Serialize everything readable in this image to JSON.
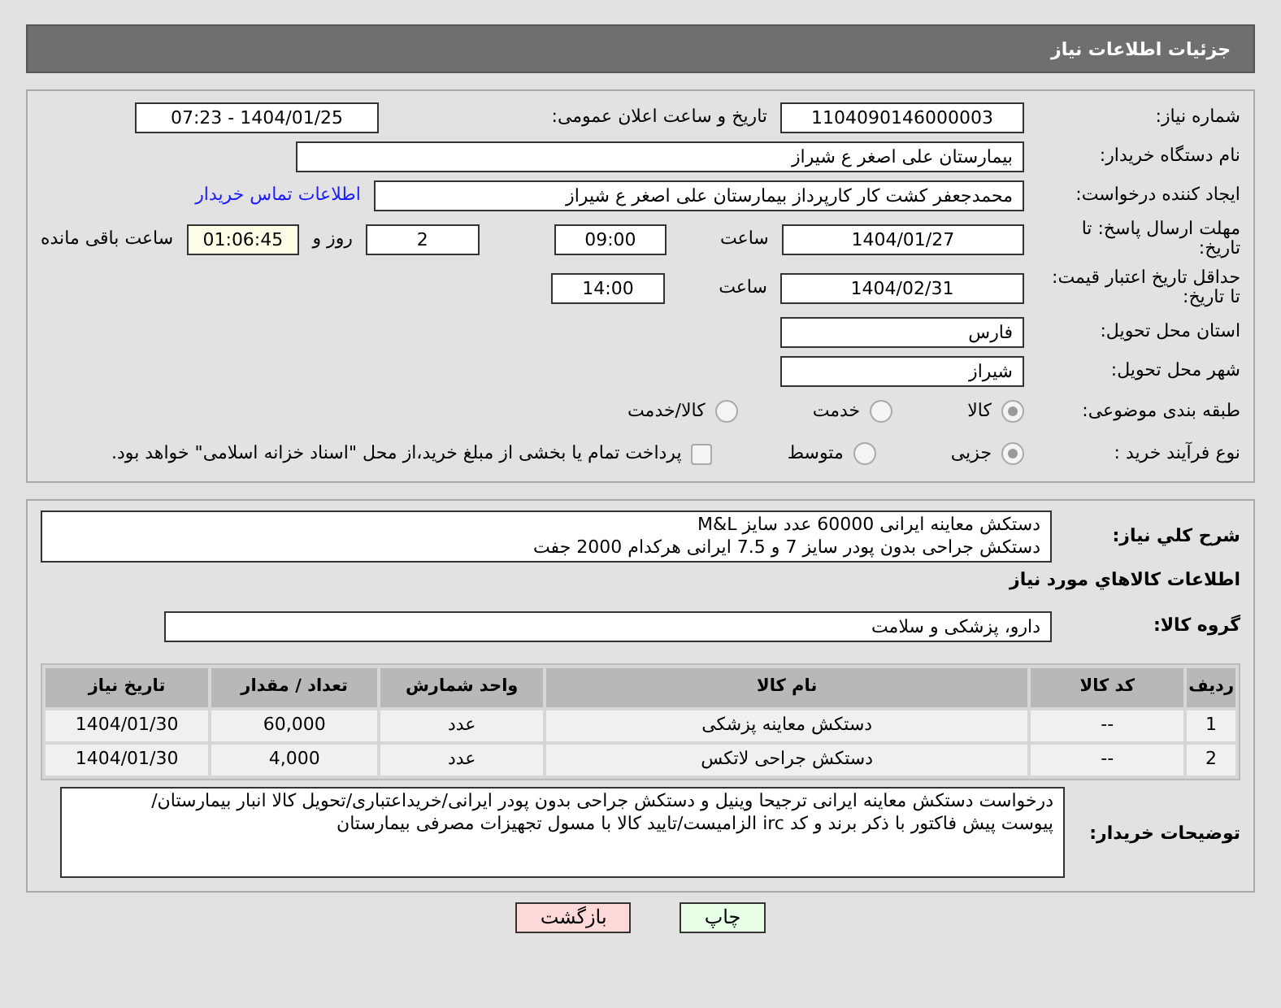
{
  "header": {
    "title": "جزئیات اطلاعات نیاز"
  },
  "fields": [
    {
      "kind": "pair",
      "label": "شماره نیاز:",
      "value": "1104090146000003",
      "label2": "تاریخ و ساعت اعلان عمومی:",
      "value2": "1404/01/25 - 07:23"
    },
    {
      "kind": "wide",
      "label": "نام دستگاه خریدار:",
      "value": "بیمارستان علی اصغر  ع  شیراز"
    },
    {
      "kind": "link",
      "label": "ایجاد کننده درخواست:",
      "value": "محمدجعفر کشت کار کارپرداز بیمارستان علی اصغر  ع  شیراز",
      "link": "اطلاعات تماس خریدار"
    },
    {
      "kind": "deadline",
      "label": "مهلت ارسال پاسخ: تا تاریخ:",
      "value": "1404/01/27",
      "time_label": "ساعت",
      "time": "09:00",
      "days": "2",
      "days_label": "روز و",
      "remaining": "01:06:45",
      "remaining_label": "ساعت باقی مانده"
    },
    {
      "kind": "time",
      "label": "حداقل تاریخ اعتبار قیمت: تا تاریخ:",
      "value": "1404/02/31",
      "time_label": "ساعت",
      "time": "14:00"
    },
    {
      "kind": "short",
      "label": "استان محل تحویل:",
      "value": "فارس"
    },
    {
      "kind": "short",
      "label": "شهر محل تحویل:",
      "value": "شیراز"
    }
  ],
  "category": {
    "label": "طبقه بندی موضوعی:",
    "options": [
      {
        "label": "کالا",
        "selected": true
      },
      {
        "label": "خدمت",
        "selected": false
      },
      {
        "label": "کالا/خدمت",
        "selected": false
      }
    ]
  },
  "process": {
    "label": "نوع فرآیند خرید :",
    "options": [
      {
        "label": "جزیی",
        "selected": true
      },
      {
        "label": "متوسط",
        "selected": false
      }
    ],
    "treasury": {
      "checked": false,
      "text": "پرداخت تمام یا بخشی از مبلغ خرید،از محل \"اسناد خزانه اسلامی\" خواهد بود."
    }
  },
  "description": {
    "label": "شرح کلي نياز:",
    "lines": [
      "دستکش معاینه ایرانی 60000 عدد سایز M&L",
      "دستکش جراحی بدون پودر سایز 7 و 7.5 ایرانی هرکدام 2000 جفت"
    ]
  },
  "items_heading": "اطلاعات كالاهاي مورد نياز",
  "goods_group": {
    "label": "گروه کالا:",
    "value": "دارو، پزشکی و سلامت"
  },
  "table": {
    "columns": [
      "ردیف",
      "کد کالا",
      "نام کالا",
      "واحد شمارش",
      "تعداد / مقدار",
      "تاریخ نیاز"
    ],
    "rows": [
      [
        "1",
        "--",
        "دستکش معاینه پزشکی",
        "عدد",
        "60,000",
        "1404/01/30"
      ],
      [
        "2",
        "--",
        "دستکش جراحی لاتکس",
        "عدد",
        "4,000",
        "1404/01/30"
      ]
    ]
  },
  "buyer_notes": {
    "label": "توضیحات خریدار:",
    "lines": [
      "درخواست دستکش معاینه ایرانی ترجیحا وینیل و دستکش جراحی بدون پودر ایرانی/خریداعتباری/تحویل کالا انبار بیمارستان/",
      "پیوست پیش فاکتور با ذکر برند و کد irc الزامیست/تایید کالا با مسول تجهیزات مصرفی بیمارستان"
    ]
  },
  "buttons": [
    {
      "kind": "print",
      "label": "چاپ"
    },
    {
      "kind": "back",
      "label": "بازگشت"
    }
  ]
}
